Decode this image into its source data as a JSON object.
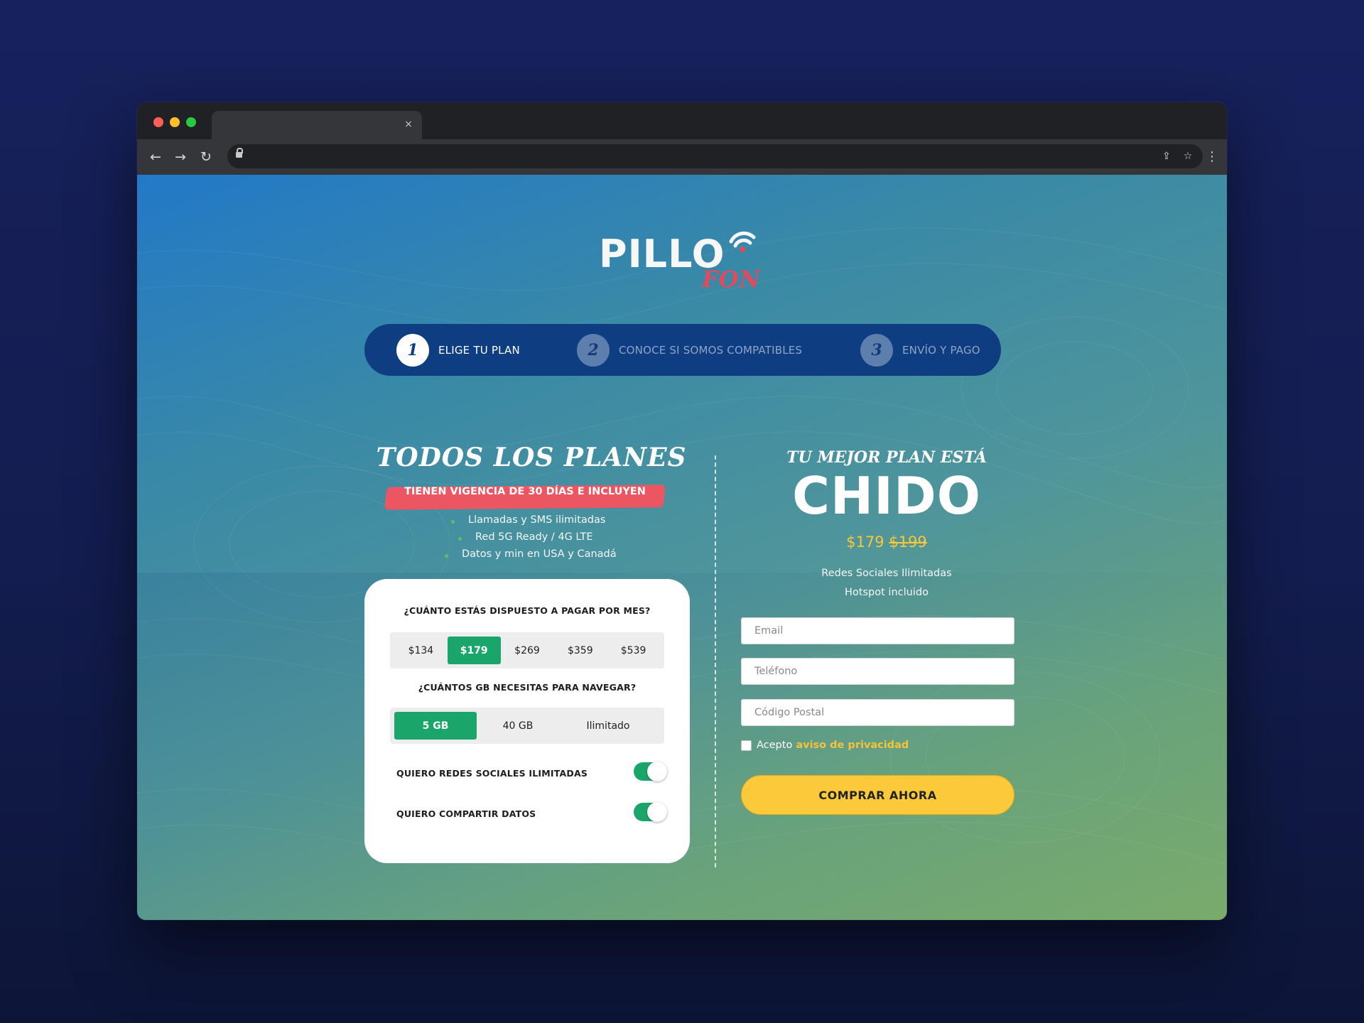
{
  "browser": {
    "tab_close_glyph": "×",
    "nav": {
      "back_glyph": "←",
      "forward_glyph": "→",
      "reload_glyph": "↻"
    },
    "toolbar_icons": {
      "share_glyph": "⇪",
      "star_glyph": "☆",
      "menu_glyph": "⋮"
    }
  },
  "logo": {
    "main": "PILLO",
    "sub": "FON"
  },
  "steps": [
    {
      "number": "1",
      "label": "ELIGE TU PLAN",
      "state": "active"
    },
    {
      "number": "2",
      "label": "CONOCE SI SOMOS COMPATIBLES",
      "state": "inactive"
    },
    {
      "number": "3",
      "label": "ENVÍO Y PAGO",
      "state": "inactive"
    }
  ],
  "plans": {
    "title": "TODOS LOS PLANES",
    "banner": "TIENEN VIGENCIA DE 30 DÍAS E INCLUYEN",
    "features": [
      "Llamadas y SMS ilimitadas",
      "Red 5G Ready / 4G LTE",
      "Datos y min en USA y Canadá"
    ]
  },
  "selector": {
    "price_question": "¿CUÁNTO ESTÁS DISPUESTO A PAGAR POR MES?",
    "price_options": [
      "$134",
      "$179",
      "$269",
      "$359",
      "$539"
    ],
    "price_selected": "$179",
    "data_question": "¿CUÁNTOS GB NECESITAS PARA NAVEGAR?",
    "data_options": [
      "5 GB",
      "40 GB",
      "Ilimitado"
    ],
    "data_selected": "5 GB",
    "toggles": [
      {
        "label": "QUIERO REDES SOCIALES ILIMITADAS",
        "on": true
      },
      {
        "label": "QUIERO COMPARTIR DATOS",
        "on": true
      }
    ]
  },
  "result": {
    "kicker": "TU MEJOR PLAN ESTÁ",
    "plan_name": "CHIDO",
    "price_current": "$179",
    "price_old": "$199",
    "features": [
      "Redes Sociales Ilimitadas",
      "Hotspot incluido"
    ]
  },
  "form": {
    "email_placeholder": "Email",
    "phone_placeholder": "Teléfono",
    "zip_placeholder": "Código Postal",
    "consent_text": "Acepto",
    "consent_link": "aviso de privacidad",
    "submit_label": "COMPRAR AHORA"
  },
  "colors": {
    "stepper_bg": "#0f3d82",
    "selected_green": "#1aa66a",
    "banner_red": "#ec5662",
    "cta_yellow": "#fcc93b",
    "price_yellow": "#f9c73a"
  }
}
